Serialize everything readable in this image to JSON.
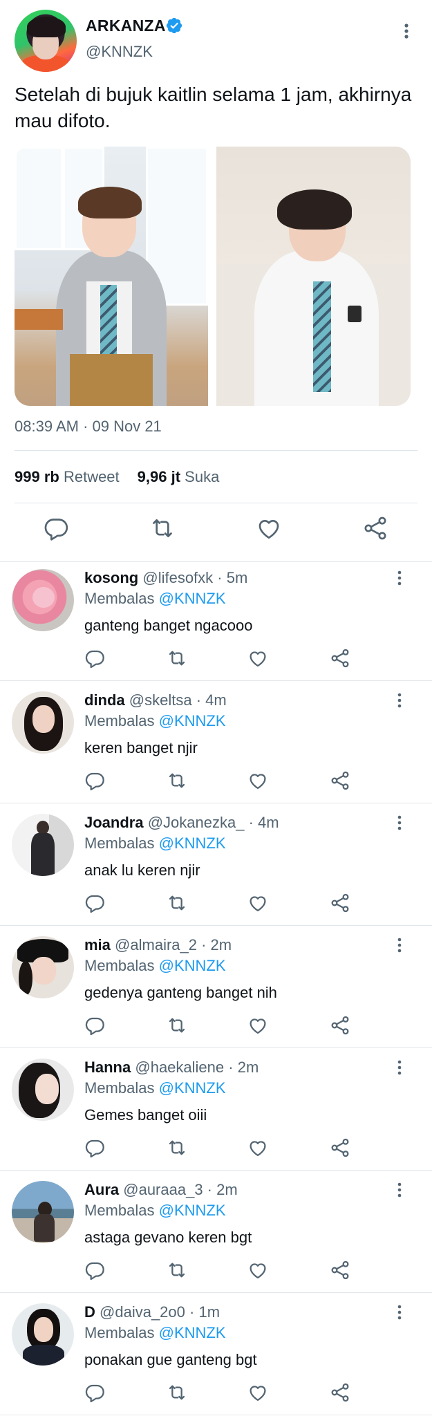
{
  "tweet": {
    "display_name": "ARKANZA",
    "handle": "@KNNZK",
    "text": "Setelah di bujuk kaitlin selama 1 jam, akhirnya mau difoto.",
    "timestamp": "08:39 AM · 09 Nov 21",
    "stats": {
      "retweets_count": "999 rb",
      "retweets_label": "Retweet",
      "likes_count": "9,96 jt",
      "likes_label": "Suka"
    },
    "icons": [
      "verified-badge-icon",
      "more-vertical-icon",
      "reply-icon",
      "retweet-icon",
      "like-icon",
      "share-icon"
    ]
  },
  "colors": {
    "accent": "#1d9bf0",
    "text_primary": "#0f1419",
    "text_secondary": "#536471",
    "divider": "#e1e6ea"
  },
  "replies": [
    {
      "name": "kosong",
      "handle": "@lifesofxk",
      "time": "5m",
      "replying_label": "Membalas",
      "replying_to": "@KNNZK",
      "text": "ganteng banget ngacooo"
    },
    {
      "name": "dinda",
      "handle": "@skeltsa",
      "time": "4m",
      "replying_label": "Membalas",
      "replying_to": "@KNNZK",
      "text": "keren banget njir"
    },
    {
      "name": "Joandra",
      "handle": "@Jokanezka_",
      "time": "4m",
      "replying_label": "Membalas",
      "replying_to": "@KNNZK",
      "text": "anak lu keren njir"
    },
    {
      "name": "mia",
      "handle": "@almaira_2",
      "time": "2m",
      "replying_label": "Membalas",
      "replying_to": "@KNNZK",
      "text": "gedenya ganteng banget nih"
    },
    {
      "name": "Hanna",
      "handle": "@haekaliene",
      "time": "2m",
      "replying_label": "Membalas",
      "replying_to": "@KNNZK",
      "text": "Gemes banget oiii"
    },
    {
      "name": "Aura",
      "handle": "@auraaa_3",
      "time": "2m",
      "replying_label": "Membalas",
      "replying_to": "@KNNZK",
      "text": "astaga gevano keren bgt"
    },
    {
      "name": "D",
      "handle": "@daiva_2o0",
      "time": "1m",
      "replying_label": "Membalas",
      "replying_to": "@KNNZK",
      "text": "ponakan gue ganteng bgt"
    }
  ]
}
